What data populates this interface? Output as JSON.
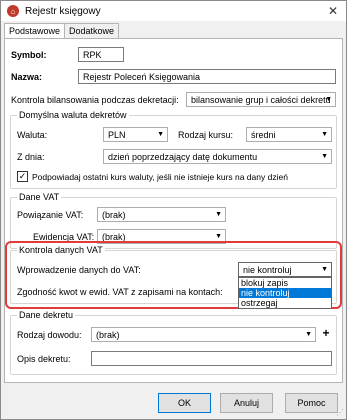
{
  "window": {
    "title": "Rejestr księgowy"
  },
  "tabs": [
    {
      "label": "Podstawowe",
      "active": true
    },
    {
      "label": "Dodatkowe",
      "active": false
    }
  ],
  "form": {
    "symbol_label": "Symbol:",
    "symbol_value": "RPK",
    "nazwa_label": "Nazwa:",
    "nazwa_value": "Rejestr Poleceń Księgowania",
    "kontrola_label": "Kontrola bilansowania podczas dekretacji:",
    "kontrola_value": "bilansowanie grup i całości dekretu"
  },
  "waluta_group": {
    "title": "Domyślna waluta dekretów",
    "waluta_label": "Waluta:",
    "waluta_value": "PLN",
    "rodzaj_kursu_label": "Rodzaj kursu:",
    "rodzaj_kursu_value": "średni",
    "z_dnia_label": "Z dnia:",
    "z_dnia_value": "dzień poprzedzający datę dokumentu",
    "podpowiadaj_label": "Podpowiadaj ostatni kurs waluty, jeśli nie istnieje kurs na dany dzień",
    "podpowiadaj_checked": true
  },
  "vat_group": {
    "title": "Dane VAT",
    "powiazanie_label": "Powiązanie VAT:",
    "powiazanie_value": "(brak)",
    "ewidencja_label": "Ewidencja VAT:",
    "ewidencja_value": "(brak)"
  },
  "kontrola_vat_group": {
    "title": "Kontrola danych VAT",
    "wprowadzenie_label": "Wprowadzenie danych do VAT:",
    "wprowadzenie_value": "nie kontroluj",
    "zgodnosc_label": "Zgodność kwot w ewid. VAT z zapisami na kontach:",
    "dropdown_options": [
      "blokuj zapis",
      "nie kontroluj",
      "ostrzegaj"
    ],
    "dropdown_selected_index": 1,
    "highlight_color": "#e03c3c"
  },
  "dekret_group": {
    "title": "Dane dekretu",
    "rodzaj_label": "Rodzaj dowodu:",
    "rodzaj_value": "(brak)",
    "opis_label": "Opis dekretu:",
    "opis_value": ""
  },
  "buttons": {
    "ok": "OK",
    "anuluj": "Anuluj",
    "pomoc": "Pomoc"
  },
  "icons": {
    "close": "close-icon",
    "app": "app-icon",
    "chevron": "chevron-down-icon",
    "plus": "plus-icon"
  }
}
